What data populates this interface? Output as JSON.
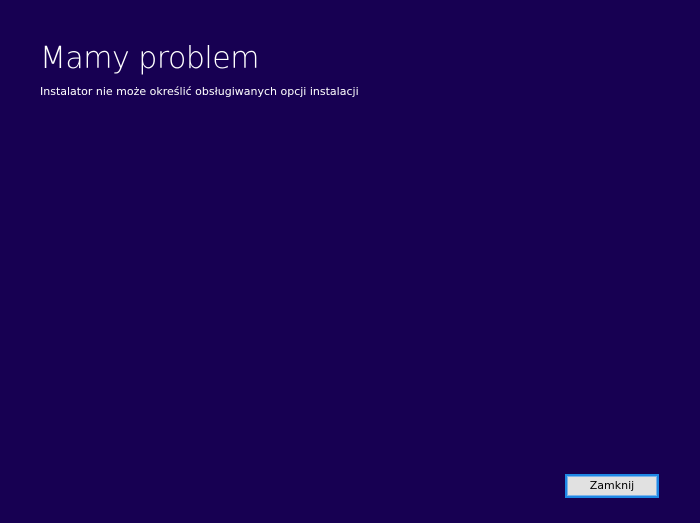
{
  "dialog": {
    "title": "Mamy problem",
    "message": "Instalator nie może określić obsługiwanych opcji instalacji",
    "close_label": "Zamknij"
  },
  "colors": {
    "background": "#170052",
    "text": "#ffffff",
    "button_face": "#e1e1e1",
    "button_focus_border": "#1e88e5"
  }
}
